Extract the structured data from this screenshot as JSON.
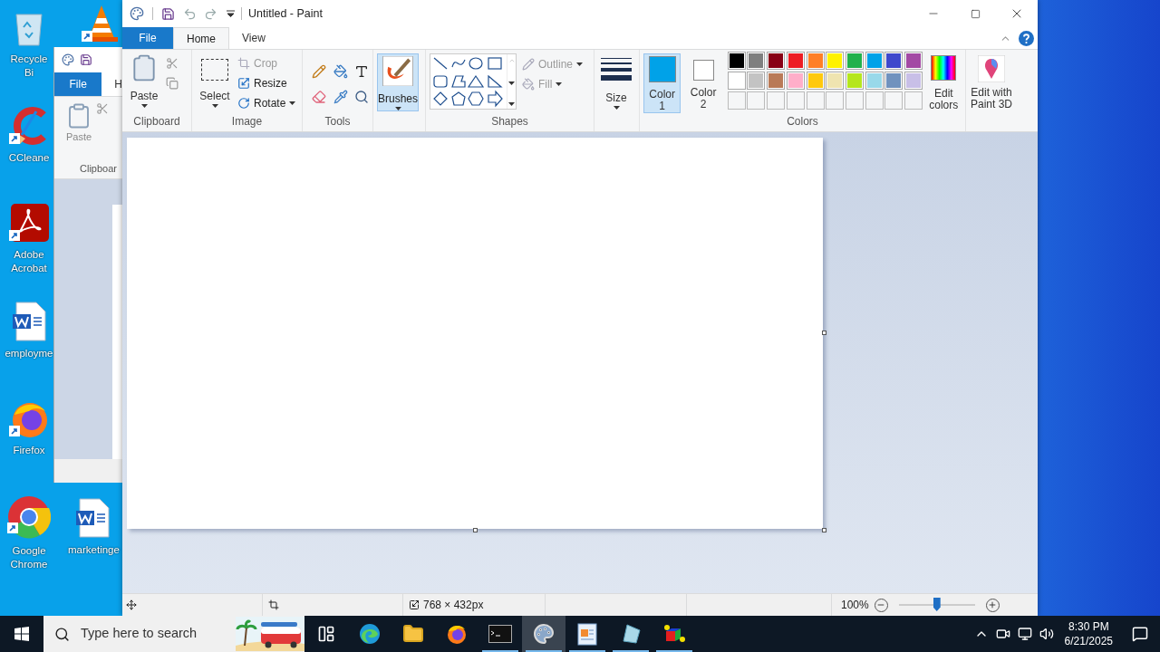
{
  "desktop": {
    "icons": [
      {
        "kind": "recycle",
        "label": "Recycle Bi"
      },
      {
        "kind": "cone"
      },
      {
        "kind": "cleaner",
        "label": "CCleane"
      },
      {
        "kind": "pdf",
        "label": "Adobe Acrobat"
      },
      {
        "kind": "document",
        "label": "employme"
      },
      {
        "kind": "fox",
        "label": "Firefox"
      },
      {
        "kind": "chrome",
        "label": "Google Chrome"
      },
      {
        "kind": "document",
        "label": "marketinge"
      }
    ]
  },
  "back_window": {
    "tabs": [
      "File",
      "H"
    ],
    "paste": "Paste",
    "group": "Clipboar"
  },
  "paint": {
    "title": "Untitled - Paint",
    "tabs": [
      {
        "label": "File",
        "kind": "file",
        "selected": false
      },
      {
        "label": "Home",
        "kind": "tab",
        "selected": true
      },
      {
        "label": "View",
        "kind": "tab",
        "selected": false
      }
    ],
    "clipboard": {
      "label": "Clipboard",
      "paste": "Paste"
    },
    "image": {
      "label": "Image",
      "select": "Select",
      "commands": [
        {
          "kind": "crop",
          "label": "Crop",
          "disabled": true
        },
        {
          "kind": "resize",
          "label": "Resize",
          "disabled": false
        },
        {
          "kind": "rotate",
          "label": "Rotate",
          "disabled": false
        }
      ]
    },
    "tools": {
      "label": "Tools"
    },
    "brushes": {
      "label": "Brushes",
      "selected": true
    },
    "shapes": {
      "label": "Shapes",
      "outline": {
        "label": "Outline",
        "disabled": true
      },
      "fill": {
        "label": "Fill",
        "disabled": true
      }
    },
    "size": {
      "label": "Size"
    },
    "colors": {
      "label": "Colors",
      "current": [
        {
          "label": "Color 1",
          "color": "#00a2e8",
          "selected": true
        },
        {
          "label": "Color 2",
          "color": "#ffffff",
          "selected": false
        }
      ],
      "palette": [
        {
          "color": "#000000"
        },
        {
          "color": "#7f7f7f"
        },
        {
          "color": "#880015"
        },
        {
          "color": "#ed1c24"
        },
        {
          "color": "#ff7f27"
        },
        {
          "color": "#fff200"
        },
        {
          "color": "#22b14c"
        },
        {
          "color": "#00a2e8"
        },
        {
          "color": "#3f48cc"
        },
        {
          "color": "#a349a4"
        },
        {
          "color": "#ffffff"
        },
        {
          "color": "#c3c3c3"
        },
        {
          "color": "#b97a57"
        },
        {
          "color": "#ffaec9"
        },
        {
          "color": "#ffc90e"
        },
        {
          "color": "#efe4b0"
        },
        {
          "color": "#b5e61d"
        },
        {
          "color": "#99d9ea"
        },
        {
          "color": "#7092be"
        },
        {
          "color": "#c8bfe7"
        }
      ],
      "edit": "Edit colors"
    },
    "paint3d": "Edit with Paint 3D",
    "status": {
      "dimensions": "768 × 432px",
      "zoom": "100%",
      "zoom_slider": {
        "level": 0.5
      }
    }
  },
  "taskbar": {
    "search": {
      "placeholder": "Type here to search"
    },
    "apps": [
      {
        "kind": "taskview",
        "running": false,
        "active": false
      },
      {
        "kind": "edge",
        "running": false,
        "active": false
      },
      {
        "kind": "folder",
        "running": false,
        "active": false
      },
      {
        "kind": "fox",
        "running": false,
        "active": false
      },
      {
        "kind": "terminal",
        "running": true,
        "active": false
      },
      {
        "kind": "paint",
        "running": true,
        "active": true
      },
      {
        "kind": "writer",
        "running": true,
        "active": false
      },
      {
        "kind": "glass",
        "running": true,
        "active": false
      },
      {
        "kind": "cube",
        "running": true,
        "active": false
      }
    ],
    "time": "8:30 PM",
    "date": "6/21/2025"
  }
}
